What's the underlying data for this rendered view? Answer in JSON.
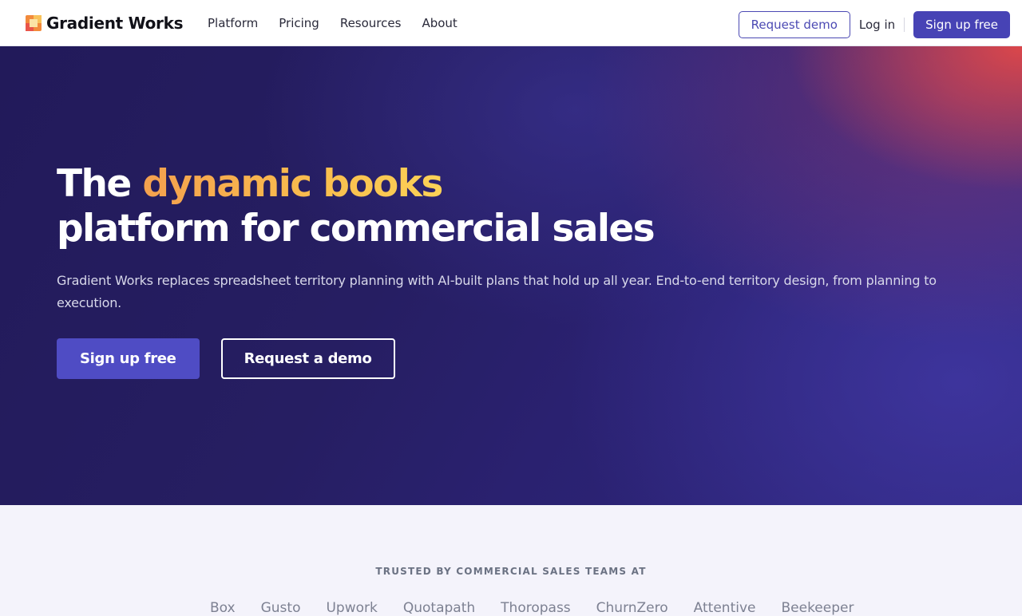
{
  "brand": {
    "name": "Gradient Works",
    "colors": {
      "accent": "#4743b5",
      "hero_dark": "#241c5e",
      "hero_red": "#e24848",
      "highlight_start": "#f4a04e",
      "highlight_end": "#fcd257"
    }
  },
  "nav": {
    "links": [
      "Platform",
      "Pricing",
      "Resources",
      "About"
    ],
    "request_demo": "Request demo",
    "login": "Log in",
    "signup": "Sign up free"
  },
  "hero": {
    "headline_prefix": "The ",
    "headline_highlight": "dynamic books",
    "headline_line2": "platform for commercial sales",
    "subtitle": "Gradient Works replaces spreadsheet territory planning with AI-built plans that hold up all year. End-to-end territory design, from planning to execution.",
    "primary_cta": "Sign up free",
    "secondary_cta": "Request a demo"
  },
  "trusted": {
    "label": "TRUSTED BY COMMERCIAL SALES TEAMS AT",
    "logos": [
      "Box",
      "Gusto",
      "Upwork",
      "Quotapath",
      "Thoropass",
      "ChurnZero",
      "Attentive",
      "Beekeeper"
    ]
  }
}
